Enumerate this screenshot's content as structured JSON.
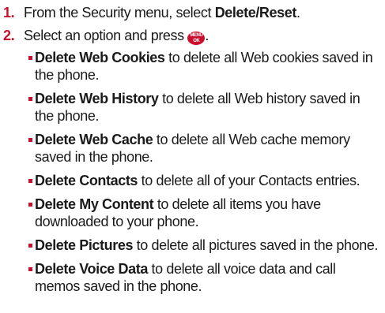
{
  "steps": [
    {
      "num": "1.",
      "text_before": "From the Security menu, select ",
      "bold": "Delete/Reset",
      "text_after": "."
    },
    {
      "num": "2.",
      "text_before": "Select an option and press ",
      "key_top": "MENU",
      "key_bottom": "OK",
      "text_after": "."
    }
  ],
  "options": [
    {
      "term": "Delete Web Cookies",
      "desc": " to delete all Web cookies saved in the phone."
    },
    {
      "term": "Delete Web History",
      "desc": " to delete all Web history saved in the phone."
    },
    {
      "term": "Delete Web Cache",
      "desc": " to delete all Web cache memory saved in the phone."
    },
    {
      "term": "Delete Contacts",
      "desc": " to delete all of your Contacts entries."
    },
    {
      "term": "Delete My Content",
      "desc": " to delete all items you have downloaded to your phone."
    },
    {
      "term": "Delete Pictures",
      "desc": " to delete all pictures saved in the phone."
    },
    {
      "term": "Delete Voice Data",
      "desc": " to delete all voice data and call memos saved in the phone."
    }
  ],
  "colors": {
    "accent": "#c8102e"
  }
}
